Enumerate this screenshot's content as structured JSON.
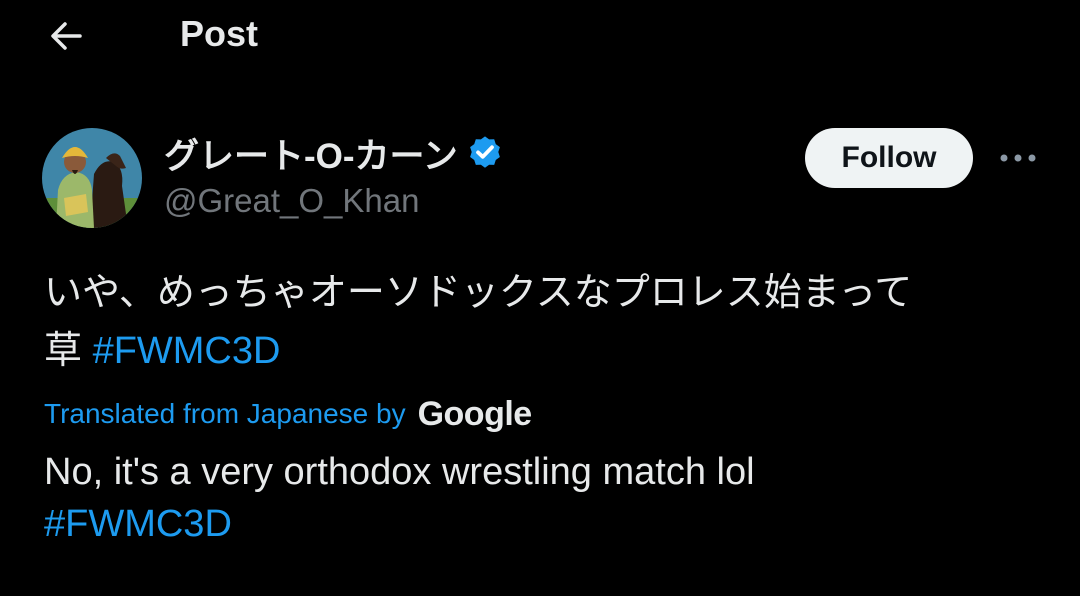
{
  "header": {
    "back_icon": "arrow-left-icon",
    "title": "Post"
  },
  "author": {
    "avatar_icon": "avatar-image",
    "display_name": "グレート-O-カーン",
    "verified_icon": "verified-badge-icon",
    "verified_color": "#1d9bf0",
    "handle": "@Great_O_Khan"
  },
  "follow_button": {
    "label": "Follow"
  },
  "more_icon": "more-options-icon",
  "tweet": {
    "text_line1": "いや、めっちゃオーソドックスなプロレス始まって",
    "text_line2_prefix": "草 ",
    "hashtag": "#FWMC3D"
  },
  "translation": {
    "label": "Translated from Japanese by",
    "provider": "Google",
    "text": "No, it's a very orthodox wrestling match lol",
    "hashtag": "#FWMC3D"
  },
  "colors": {
    "background": "#000000",
    "text": "#e7e9ea",
    "secondary_text": "#71767b",
    "link": "#1d9bf0",
    "follow_bg": "#eff3f4"
  }
}
